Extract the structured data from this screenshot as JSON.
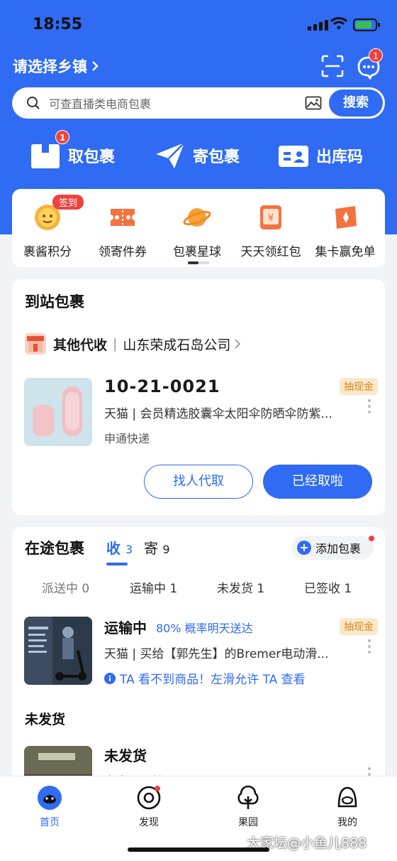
{
  "status_bar": {
    "time": "18:55"
  },
  "header": {
    "location": "请选择乡镇",
    "message_badge": "1"
  },
  "search": {
    "placeholder": "可查直播类电商包裹",
    "button": "搜索"
  },
  "quick_actions": [
    {
      "label": "取包裹",
      "badge": "1",
      "icon": "package-icon"
    },
    {
      "label": "寄包裹",
      "icon": "paper-plane-icon"
    },
    {
      "label": "出库码",
      "icon": "id-card-icon"
    }
  ],
  "services": {
    "checkin_tag": "签到",
    "items": [
      {
        "label": "裹酱积分",
        "icon": "points-icon"
      },
      {
        "label": "领寄件券",
        "icon": "coupon-icon"
      },
      {
        "label": "包裹星球",
        "icon": "planet-icon"
      },
      {
        "label": "天天领红包",
        "icon": "red-packet-icon"
      },
      {
        "label": "集卡赢免单",
        "icon": "card-icon"
      }
    ]
  },
  "arrived": {
    "title": "到站包裹",
    "station_type": "其他代收",
    "station_name": "山东荣成石岛公司",
    "parcel": {
      "code": "10-21-0021",
      "tag": "抽现金",
      "description": "天猫 | 会员精选胶囊伞太阳伞防晒伞防紫...",
      "courier": "申通快递"
    },
    "btn_proxy": "找人代取",
    "btn_picked": "已经取啦"
  },
  "transit": {
    "title": "在途包裹",
    "tab_receive": "收",
    "tab_receive_count": "3",
    "tab_send": "寄",
    "tab_send_count": "9",
    "add_button": "添加包裹",
    "subtabs": [
      "派送中 0",
      "运输中 1",
      "未发货 1",
      "已签收 1"
    ],
    "parcel1": {
      "status": "运输中",
      "eta": "80% 概率明天送达",
      "tag": "抽现金",
      "description": "天猫 | 买给【郭先生】的Bremer电动滑...",
      "notice": "TA 看不到商品！左滑允许 TA 查看"
    },
    "section_unshipped": "未发货",
    "parcel2": {
      "status": "未发货",
      "description": "淘宝 | 买给..."
    }
  },
  "tabbar": {
    "items": [
      {
        "label": "首页",
        "icon": "home-icon"
      },
      {
        "label": "发现",
        "icon": "eye-icon"
      },
      {
        "label": "果园",
        "icon": "orchard-icon"
      },
      {
        "label": "我的",
        "icon": "profile-icon"
      }
    ]
  },
  "watermark": "大家坛@小鱼儿888",
  "colors": {
    "primary": "#2f6bf3",
    "badge": "#f0413f",
    "cash_tag": "#d5861b"
  }
}
